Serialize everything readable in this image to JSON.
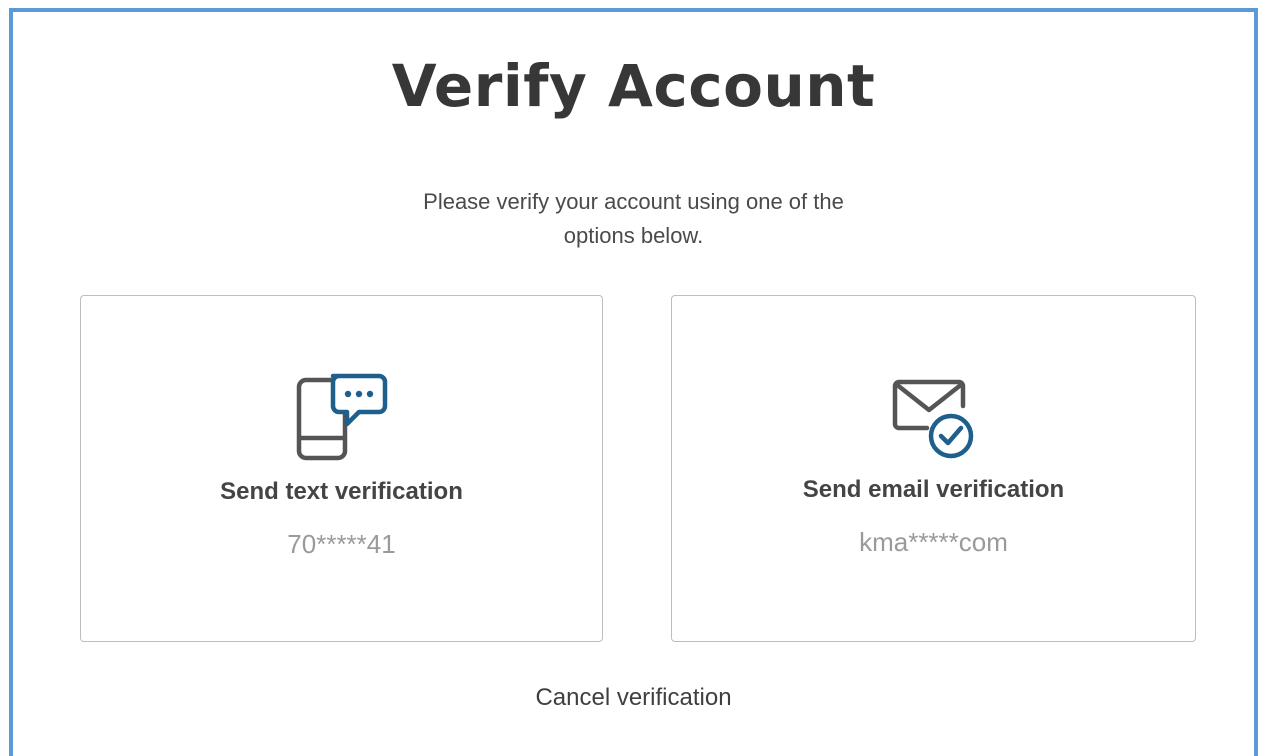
{
  "header": {
    "title": "Verify Account",
    "subtitle": "Please verify your account using one of the options below."
  },
  "options": [
    {
      "label": "Send text verification",
      "value": "70*****41",
      "icon": "phone-chat-icon"
    },
    {
      "label": "Send email verification",
      "value": "kma*****com",
      "icon": "email-check-icon"
    }
  ],
  "footer": {
    "cancel_label": "Cancel verification"
  },
  "colors": {
    "accent": "#1f5f8b",
    "border": "#5b9bd5",
    "icon_gray": "#555555",
    "value_gray": "#9a9a9a"
  }
}
